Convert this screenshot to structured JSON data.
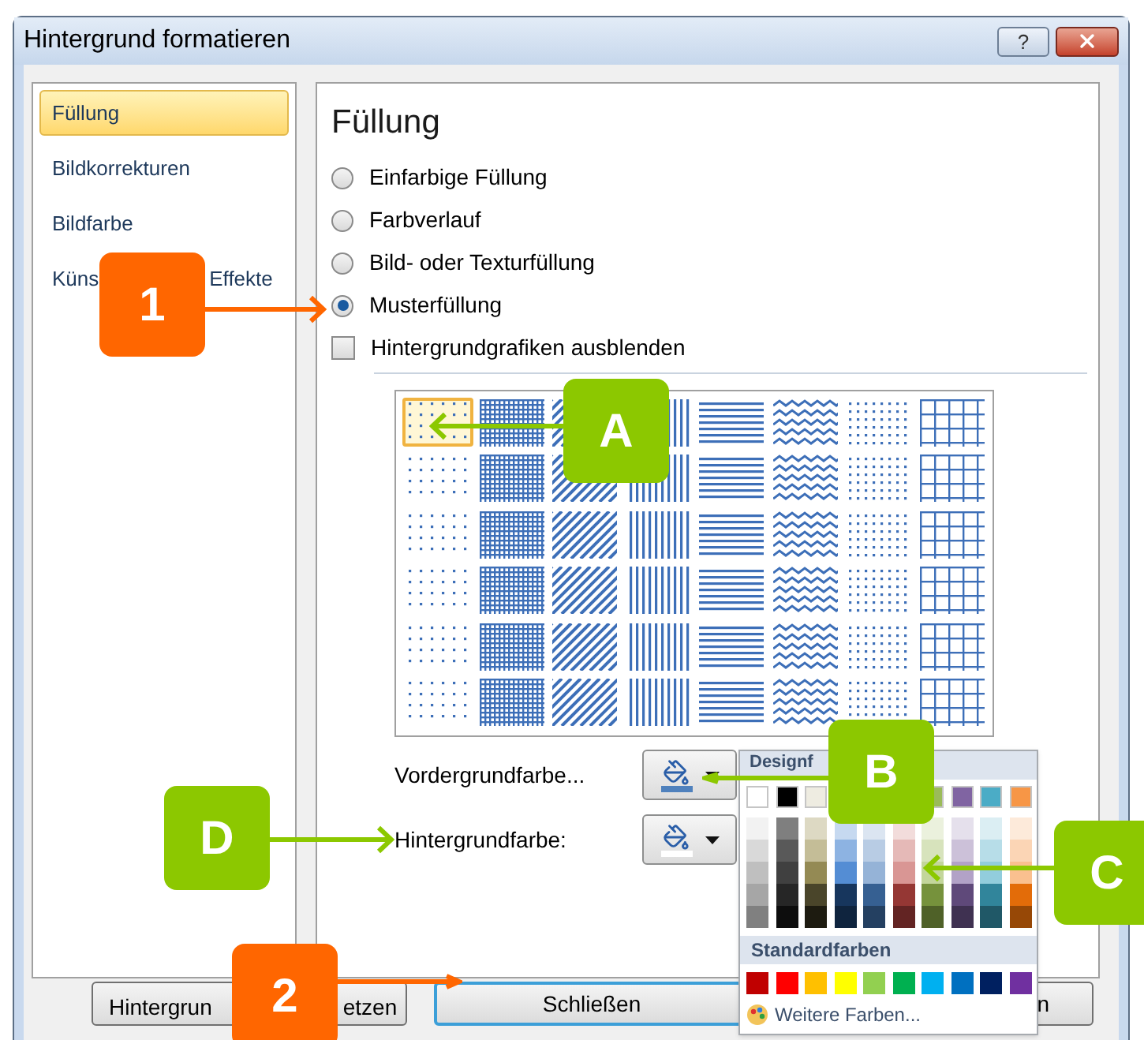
{
  "window": {
    "title": "Hintergrund formatieren",
    "help": "?"
  },
  "sidebar": {
    "items": [
      {
        "label": "Füllung",
        "selected": true
      },
      {
        "label": "Bildkorrekturen",
        "selected": false
      },
      {
        "label": "Bildfarbe",
        "selected": false
      },
      {
        "label": "Küns",
        "label_tail": "Effekte",
        "selected": false
      }
    ]
  },
  "panel": {
    "heading": "Füllung",
    "options": [
      {
        "label": "Einfarbige Füllung",
        "selected": false
      },
      {
        "label": "Farbverlauf",
        "selected": false
      },
      {
        "label": "Bild- oder Texturfüllung",
        "selected": false
      },
      {
        "label": "Musterfüllung",
        "selected": true
      }
    ],
    "hide_graphics": {
      "label": "Hintergrundgrafiken ausblenden",
      "checked": false
    },
    "patterns": [
      {
        "selected": true
      },
      {
        "selected": false
      },
      {
        "selected": false
      },
      {
        "selected": false
      },
      {
        "selected": false
      },
      {
        "selected": false
      },
      {
        "selected": false
      },
      {
        "selected": false
      },
      {
        "selected": false
      },
      {
        "selected": false
      },
      {
        "selected": false
      },
      {
        "selected": false
      },
      {
        "selected": false
      },
      {
        "selected": false
      },
      {
        "selected": false
      },
      {
        "selected": false
      },
      {
        "selected": false
      },
      {
        "selected": false
      },
      {
        "selected": false
      },
      {
        "selected": false
      },
      {
        "selected": false
      },
      {
        "selected": false
      },
      {
        "selected": false
      },
      {
        "selected": false
      },
      {
        "selected": false
      },
      {
        "selected": false
      },
      {
        "selected": false
      },
      {
        "selected": false
      },
      {
        "selected": false
      },
      {
        "selected": false
      },
      {
        "selected": false
      },
      {
        "selected": false
      },
      {
        "selected": false
      },
      {
        "selected": false
      },
      {
        "selected": false
      },
      {
        "selected": false
      },
      {
        "selected": false
      },
      {
        "selected": false
      },
      {
        "selected": false
      },
      {
        "selected": false
      },
      {
        "selected": false
      },
      {
        "selected": false
      },
      {
        "selected": false
      },
      {
        "selected": false
      },
      {
        "selected": false
      },
      {
        "selected": false
      },
      {
        "selected": false
      },
      {
        "selected": false
      }
    ],
    "foreground": {
      "label": "Vordergrundfarbe...",
      "color": "#4f81bd"
    },
    "background": {
      "label": "Hintergrundfarbe:",
      "color": "#ffffff"
    }
  },
  "color_menu": {
    "heading": "Designf",
    "theme_colors": [
      {
        "color": "#ffffff",
        "shades": [
          {
            "color": "#f2f2f2"
          },
          {
            "color": "#d9d9d9"
          },
          {
            "color": "#bfbfbf"
          },
          {
            "color": "#a6a6a6"
          },
          {
            "color": "#808080"
          }
        ]
      },
      {
        "color": "#000000",
        "shades": [
          {
            "color": "#7f7f7f"
          },
          {
            "color": "#595959"
          },
          {
            "color": "#404040"
          },
          {
            "color": "#262626"
          },
          {
            "color": "#0d0d0d"
          }
        ]
      },
      {
        "color": "#eeece1",
        "shades": [
          {
            "color": "#ddd9c3"
          },
          {
            "color": "#c4bd97"
          },
          {
            "color": "#948a54"
          },
          {
            "color": "#4a452a"
          },
          {
            "color": "#1d1b10"
          }
        ]
      },
      {
        "shades": [
          {
            "color": "#c6d9f0"
          },
          {
            "color": "#8db3e2"
          },
          {
            "color": "#548dd4"
          },
          {
            "color": "#17365d"
          },
          {
            "color": "#0f243e"
          }
        ]
      },
      {
        "shades": [
          {
            "color": "#dbe5f1"
          },
          {
            "color": "#b8cce4"
          },
          {
            "color": "#95b3d7"
          },
          {
            "color": "#366092"
          },
          {
            "color": "#244061"
          }
        ]
      },
      {
        "shades": [
          {
            "color": "#f2dcdb"
          },
          {
            "color": "#e5b9b7"
          },
          {
            "color": "#d99694"
          },
          {
            "color": "#953734"
          },
          {
            "color": "#632423"
          }
        ]
      },
      {
        "color": "#9bbb59",
        "shades": [
          {
            "color": "#ebf1dd"
          },
          {
            "color": "#d7e3bc"
          },
          {
            "color": "#c3d69b"
          },
          {
            "color": "#76923c"
          },
          {
            "color": "#4f6128"
          }
        ]
      },
      {
        "color": "#8064a2",
        "shades": [
          {
            "color": "#e5e0ec"
          },
          {
            "color": "#ccc1d9"
          },
          {
            "color": "#b2a2c7"
          },
          {
            "color": "#5f497a"
          },
          {
            "color": "#3f3151"
          }
        ]
      },
      {
        "color": "#4bacc6",
        "shades": [
          {
            "color": "#dbeef3"
          },
          {
            "color": "#b7dde8"
          },
          {
            "color": "#92cddc"
          },
          {
            "color": "#31859b"
          },
          {
            "color": "#205867"
          }
        ]
      },
      {
        "color": "#f79646",
        "shades": [
          {
            "color": "#fdeada"
          },
          {
            "color": "#fbd5b5"
          },
          {
            "color": "#fac08f"
          },
          {
            "color": "#e36c09"
          },
          {
            "color": "#974806"
          }
        ]
      }
    ],
    "standard_heading": "Standardfarben",
    "standard_colors": [
      {
        "color": "#c00000"
      },
      {
        "color": "#ff0000"
      },
      {
        "color": "#ffc000"
      },
      {
        "color": "#ffff00"
      },
      {
        "color": "#92d050"
      },
      {
        "color": "#00b050"
      },
      {
        "color": "#00b0f0"
      },
      {
        "color": "#0070c0"
      },
      {
        "color": "#002060"
      },
      {
        "color": "#7030a0"
      }
    ],
    "more": "Weitere Farben..."
  },
  "buttons": [
    {
      "label": "Hintergrun",
      "label_tail": "etzen"
    },
    {
      "label": "Schließen",
      "selected": true
    },
    {
      "label": "n",
      "selected": false
    }
  ],
  "callouts": [
    {
      "label": "1",
      "color": "#ff6600"
    },
    {
      "label": "A",
      "color": "#8cc800"
    },
    {
      "label": "B",
      "color": "#8cc800"
    },
    {
      "label": "C",
      "color": "#8cc800"
    },
    {
      "label": "D",
      "color": "#8cc800"
    },
    {
      "label": "2",
      "color": "#ff6600"
    }
  ]
}
